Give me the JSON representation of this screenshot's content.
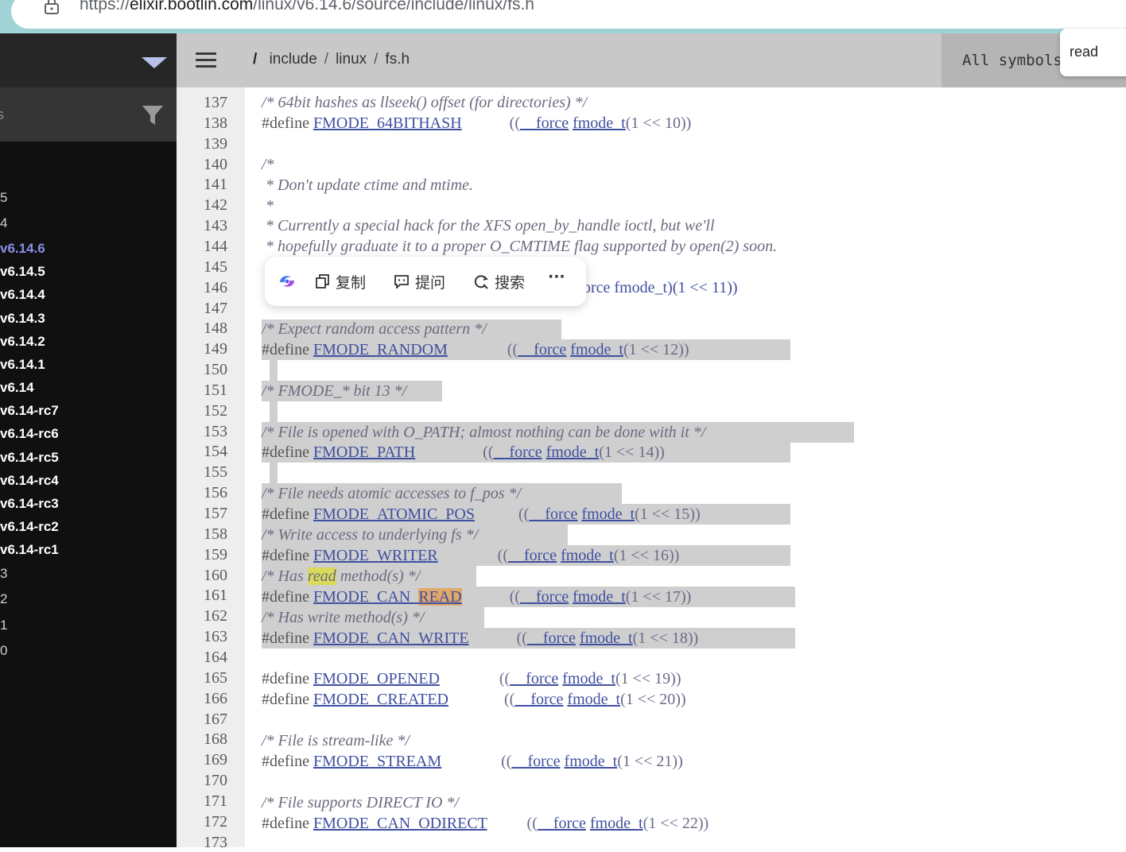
{
  "browser": {
    "url_scheme": "https://",
    "url_host": "elixir.bootlin.com",
    "url_path": "/linux/v6.14.6/source/include/linux/fs.h"
  },
  "sidebar": {
    "filter_placeholder": "s",
    "versions": [
      {
        "label": "5",
        "state": "dim"
      },
      {
        "label": "4",
        "state": "dim"
      },
      {
        "label": "v6.14.6",
        "state": "active"
      },
      {
        "label": "v6.14.5",
        "state": "normal"
      },
      {
        "label": "v6.14.4",
        "state": "normal"
      },
      {
        "label": "v6.14.3",
        "state": "normal"
      },
      {
        "label": "v6.14.2",
        "state": "normal"
      },
      {
        "label": "v6.14.1",
        "state": "normal"
      },
      {
        "label": "v6.14",
        "state": "normal"
      },
      {
        "label": "v6.14-rc7",
        "state": "normal"
      },
      {
        "label": "v6.14-rc6",
        "state": "normal"
      },
      {
        "label": "v6.14-rc5",
        "state": "normal"
      },
      {
        "label": "v6.14-rc4",
        "state": "normal"
      },
      {
        "label": "v6.14-rc3",
        "state": "normal"
      },
      {
        "label": "v6.14-rc2",
        "state": "normal"
      },
      {
        "label": "v6.14-rc1",
        "state": "normal"
      },
      {
        "label": "3",
        "state": "dim"
      },
      {
        "label": "2",
        "state": "dim"
      },
      {
        "label": "1",
        "state": "dim"
      },
      {
        "label": "0",
        "state": "dim"
      }
    ]
  },
  "header": {
    "root": "/",
    "crumbs": [
      "include",
      "linux",
      "fs.h"
    ],
    "symbols_label": "All symbols",
    "search_value": "read"
  },
  "context_menu": {
    "copy": "复制",
    "ask": "提问",
    "search": "搜索",
    "more": "···"
  },
  "lines": [
    {
      "n": "137"
    },
    {
      "n": "138"
    },
    {
      "n": "139"
    },
    {
      "n": "140"
    },
    {
      "n": "141"
    },
    {
      "n": "142"
    },
    {
      "n": "143"
    },
    {
      "n": "144"
    },
    {
      "n": "145"
    },
    {
      "n": "146"
    },
    {
      "n": "147"
    },
    {
      "n": "148"
    },
    {
      "n": "149"
    },
    {
      "n": "150"
    },
    {
      "n": "151"
    },
    {
      "n": "152"
    },
    {
      "n": "153"
    },
    {
      "n": "154"
    },
    {
      "n": "155"
    },
    {
      "n": "156"
    },
    {
      "n": "157"
    },
    {
      "n": "158"
    },
    {
      "n": "159"
    },
    {
      "n": "160"
    },
    {
      "n": "161"
    },
    {
      "n": "162"
    },
    {
      "n": "163"
    },
    {
      "n": "164"
    },
    {
      "n": "165"
    },
    {
      "n": "166"
    },
    {
      "n": "167"
    },
    {
      "n": "168"
    },
    {
      "n": "169"
    },
    {
      "n": "170"
    },
    {
      "n": "171"
    },
    {
      "n": "172"
    },
    {
      "n": "173"
    }
  ],
  "code": {
    "l137": "/* 64bit hashes as llseek() offset (for directories) */",
    "l140": "/*",
    "l141": " * Don't update ctime and mtime.",
    "l142": " *",
    "l143": " * Currently a special hack for the XFS open_by_handle ioctl, but we'll",
    "l144": " * hopefully graduate it to a proper O_CMTIME flag supported by open(2) soon.",
    "l146_tail": "orce fmode_t)(1 << 11))",
    "l148": "/* Expect random access pattern */",
    "l151": "/* FMODE_* bit 13 */",
    "l153": "/* File is opened with O_PATH; almost nothing can be done with it */",
    "l156": "/* File needs atomic accesses to f_pos */",
    "l158": "/* Write access to underlying fs */",
    "l160_a": "/* Has ",
    "l160_hl": "read",
    "l160_b": " method(s) */",
    "l162": "/* Has write method(s) */",
    "l168": "/* File is stream-like */",
    "l171": "/* File supports DIRECT IO */",
    "define": "#define",
    "force": "__force",
    "fmode_t": "fmode_t",
    "defs": {
      "l138": {
        "name": "FMODE_64BITHASH",
        "shift": "(1 << 10))"
      },
      "l149": {
        "name": "FMODE_RANDOM",
        "shift": "(1 << 12))"
      },
      "l154": {
        "name": "FMODE_PATH",
        "shift": "(1 << 14))"
      },
      "l157": {
        "name": "FMODE_ATOMIC_POS",
        "shift": "(1 << 15))"
      },
      "l159": {
        "name": "FMODE_WRITER",
        "shift": "(1 << 16))"
      },
      "l161": {
        "name_a": "FMODE_CAN_",
        "name_hl": "READ",
        "shift": "(1 << 17))"
      },
      "l163": {
        "name": "FMODE_CAN_WRITE",
        "shift": "(1 << 18))"
      },
      "l165": {
        "name": "FMODE_OPENED",
        "shift": "(1 << 19))"
      },
      "l166": {
        "name": "FMODE_CREATED",
        "shift": "(1 << 20))"
      },
      "l169": {
        "name": "FMODE_STREAM",
        "shift": "(1 << 21))"
      },
      "l172": {
        "name": "FMODE_CAN_ODIRECT",
        "shift": "(1 << 22))"
      }
    }
  },
  "colors": {
    "selection": "#cfcfcf",
    "match_highlight": "#d9d95a",
    "ident_match_highlight": "#e0a86a",
    "active_version": "#8b8fe6"
  }
}
